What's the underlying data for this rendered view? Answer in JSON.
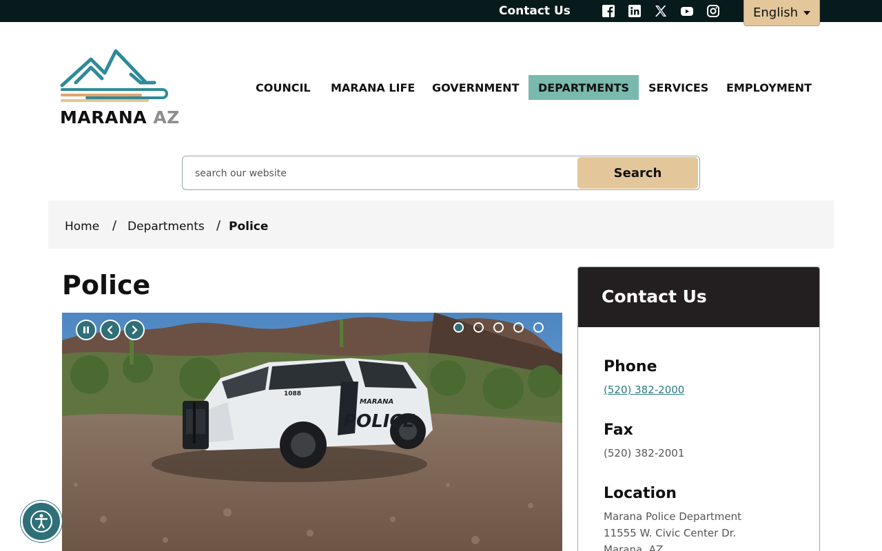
{
  "topbar": {
    "contact_label": "Contact Us",
    "social": [
      "facebook-icon",
      "linkedin-icon",
      "x-icon",
      "youtube-icon",
      "instagram-icon"
    ],
    "language": "English"
  },
  "logo": {
    "name": "MARANA",
    "suffix": "AZ"
  },
  "nav": {
    "items": [
      "COUNCIL",
      "MARANA LIFE",
      "GOVERNMENT",
      "DEPARTMENTS",
      "SERVICES",
      "EMPLOYMENT"
    ],
    "active": "DEPARTMENTS"
  },
  "search": {
    "placeholder": "search our website",
    "button": "Search"
  },
  "breadcrumb": {
    "home": "Home",
    "departments": "Departments",
    "current": "Police",
    "sep": "/"
  },
  "page": {
    "title": "Police"
  },
  "slideshow": {
    "slides": 5,
    "active_index": 0,
    "vehicle_text_small": "MARANA",
    "vehicle_text_large": "POLICE",
    "unit_number": "1088"
  },
  "contact": {
    "heading": "Contact Us",
    "phone_label": "Phone",
    "phone": "(520) 382-2000",
    "fax_label": "Fax",
    "fax": "(520) 382-2001",
    "location_label": "Location",
    "location_line1": "Marana Police Department",
    "location_line2": "11555 W. Civic Center Dr.",
    "location_line3": "Marana, AZ"
  },
  "colors": {
    "teal": "#79b9ae",
    "gold": "#e3c79b",
    "dark": "#071a1c",
    "accent": "#2e6f78"
  }
}
